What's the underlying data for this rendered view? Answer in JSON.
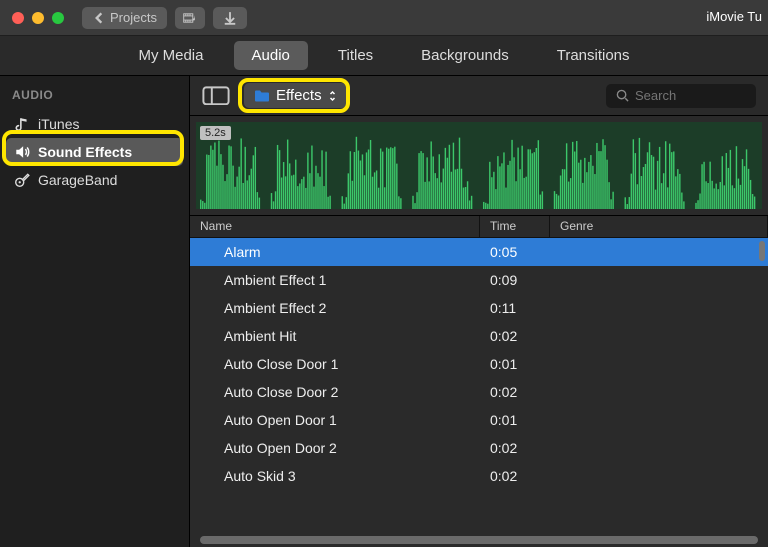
{
  "window": {
    "title": "iMovie Tu"
  },
  "toolbar_top": {
    "projects": "Projects"
  },
  "tabs": [
    "My Media",
    "Audio",
    "Titles",
    "Backgrounds",
    "Transitions"
  ],
  "active_tab": 1,
  "sidebar": {
    "heading": "AUDIO",
    "items": [
      {
        "icon": "music-note-icon",
        "label": "iTunes"
      },
      {
        "icon": "speaker-icon",
        "label": "Sound Effects",
        "selected": true
      },
      {
        "icon": "guitar-icon",
        "label": "GarageBand"
      }
    ]
  },
  "browser": {
    "folder_label": "Effects",
    "search_placeholder": "Search",
    "waveform_duration": "5.2s"
  },
  "columns": {
    "name": "Name",
    "time": "Time",
    "genre": "Genre"
  },
  "tracks": [
    {
      "name": "Alarm",
      "time": "0:05",
      "selected": true
    },
    {
      "name": "Ambient Effect 1",
      "time": "0:09"
    },
    {
      "name": "Ambient Effect 2",
      "time": "0:11"
    },
    {
      "name": "Ambient Hit",
      "time": "0:02"
    },
    {
      "name": "Auto Close Door 1",
      "time": "0:01"
    },
    {
      "name": "Auto Close Door 2",
      "time": "0:02"
    },
    {
      "name": "Auto Open Door 1",
      "time": "0:01"
    },
    {
      "name": "Auto Open Door 2",
      "time": "0:02"
    },
    {
      "name": "Auto Skid 3",
      "time": "0:02"
    }
  ]
}
